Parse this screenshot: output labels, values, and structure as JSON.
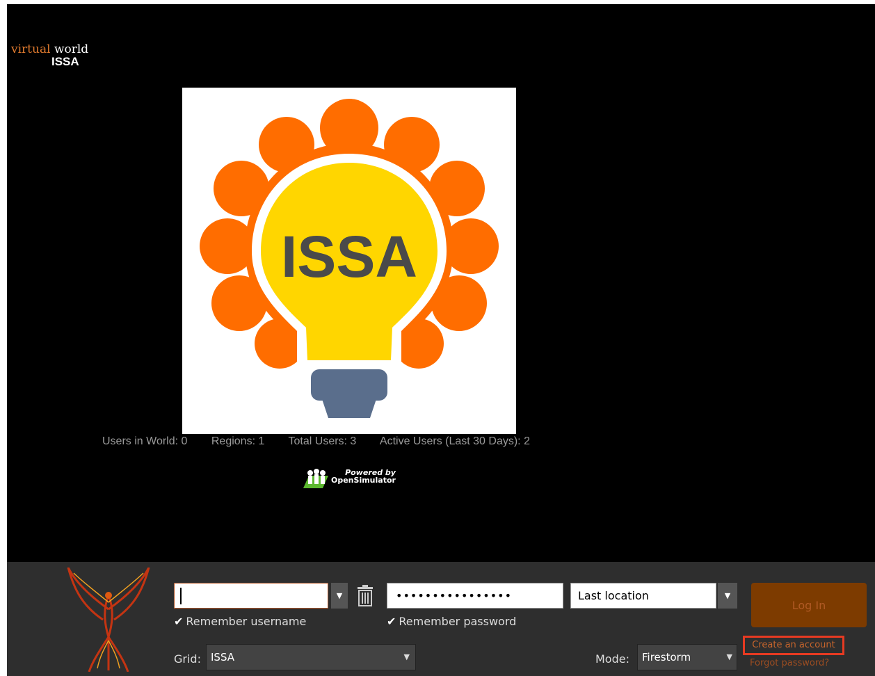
{
  "brand": {
    "word1": "virtual",
    "word2": "world",
    "line2": "ISSA"
  },
  "logo": {
    "text": "ISSA",
    "gear_color": "#ff6d00",
    "bulb_color": "#ffd600",
    "base_color": "#5a6e8c"
  },
  "stats": {
    "users_in_world": "Users in World: 0",
    "regions": "Regions: 1",
    "total_users": "Total Users: 3",
    "active_users": "Active Users (Last 30 Days): 2"
  },
  "powered": {
    "line1": "Powered by",
    "line2": "OpenSimulator"
  },
  "login": {
    "username_value": "",
    "password_value": "••••••••••••••••",
    "location_value": "Last location",
    "remember_username": "Remember username",
    "remember_password": "Remember password",
    "grid_label": "Grid:",
    "grid_value": "ISSA",
    "mode_label": "Mode:",
    "mode_value": "Firestorm",
    "login_button": "Log In",
    "create_account": "Create an account",
    "forgot_password": "Forgot password?"
  },
  "icons": {
    "dropdown": "▼",
    "check": "✔",
    "trash": "trash-icon"
  },
  "colors": {
    "accent": "#e07a2e",
    "highlight_box": "#e63a22",
    "login_button": "#7d3b00"
  }
}
